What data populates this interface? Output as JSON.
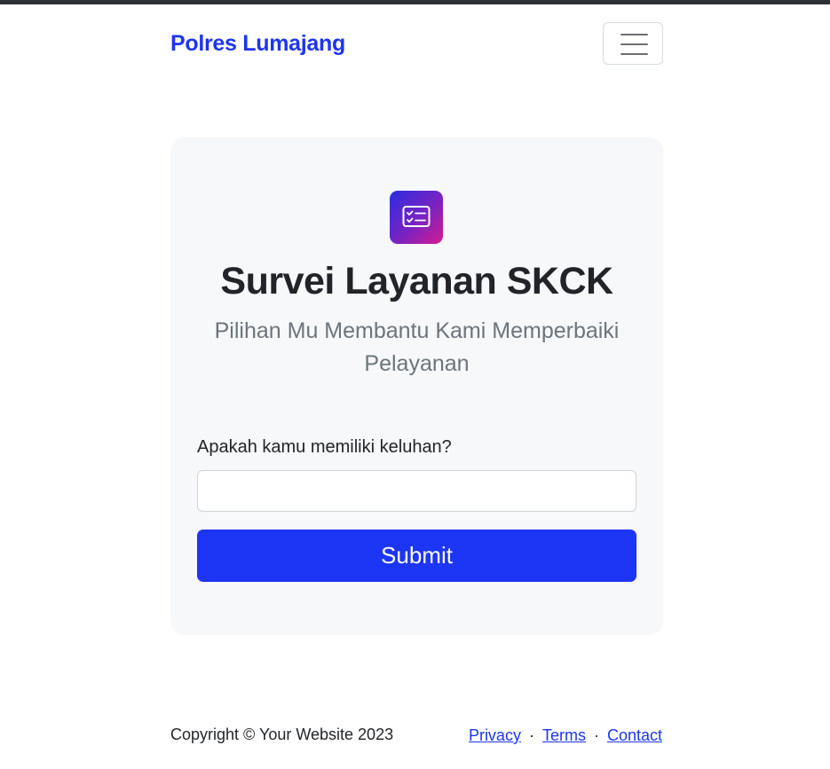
{
  "navbar": {
    "brand": "Polres Lumajang",
    "menu_icon": "hamburger-menu-icon"
  },
  "card": {
    "icon": "checklist-card-icon",
    "title": "Survei Layanan SKCK",
    "subtitle": "Pilihan Mu Membantu Kami Memperbaiki Pelayanan",
    "form": {
      "question_label": "Apakah kamu memiliki keluhan?",
      "input_value": "",
      "submit_label": "Submit"
    }
  },
  "footer": {
    "copyright": "Copyright © Your Website 2023",
    "links": {
      "privacy": "Privacy",
      "terms": "Terms",
      "contact": "Contact"
    },
    "separator": "·"
  },
  "colors": {
    "brand": "#1d35f0",
    "primary_button": "#1d35f5",
    "card_background": "#f7f8fa",
    "icon_gradient": [
      "#2c2fe0",
      "#d61d8f"
    ]
  }
}
